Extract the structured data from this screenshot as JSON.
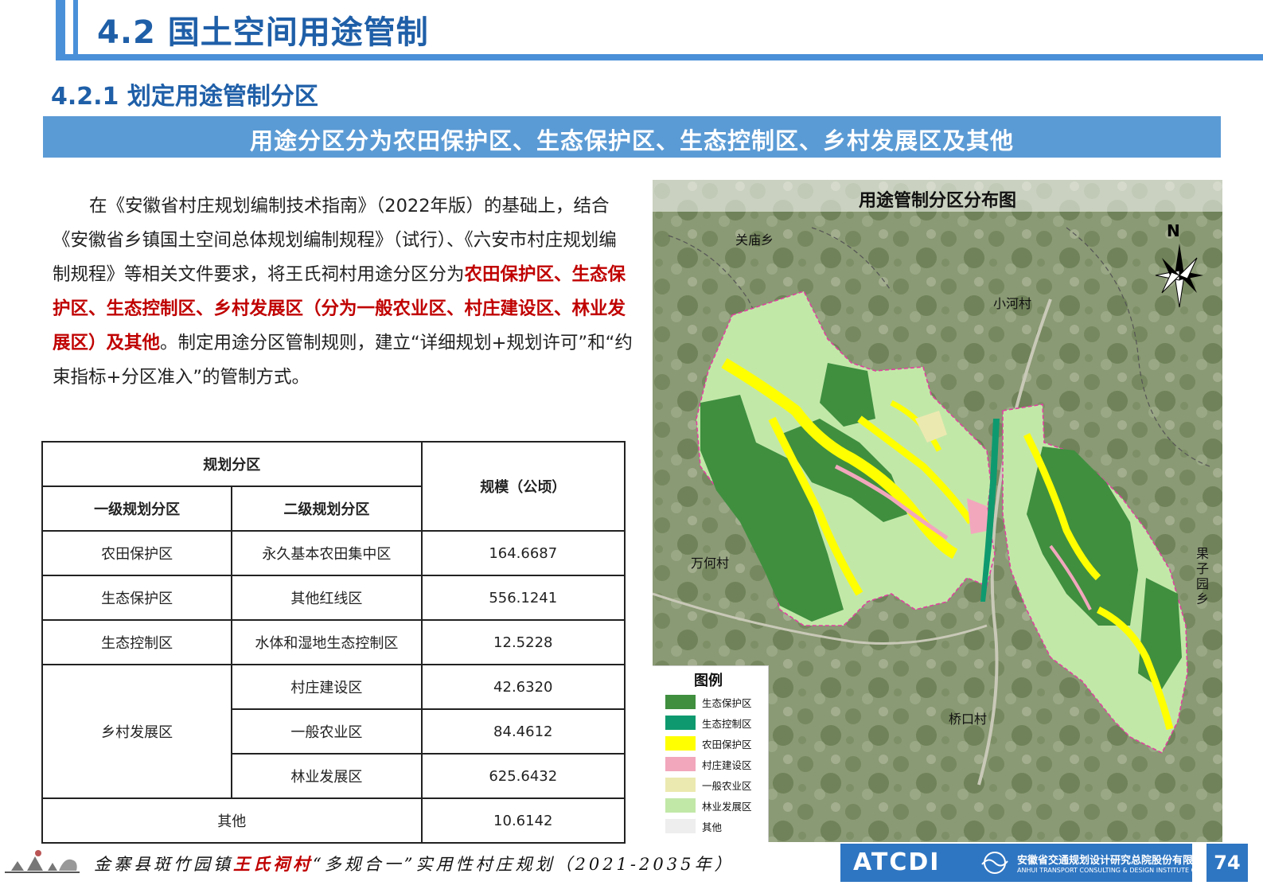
{
  "header": {
    "title": "4.2 国土空间用途管制"
  },
  "section": {
    "title": "4.2.1 划定用途管制分区"
  },
  "banner": {
    "text": "用途分区分为农田保护区、生态保护区、生态控制区、乡村发展区及其他"
  },
  "paragraph": {
    "part1": "在《安徽省村庄规划编制技术指南》（2022年版）的基础上，结合《安徽省乡镇国土空间总体规划编制规程》（试行）、《六安市村庄规划编制规程》等相关文件要求，将王氏祠村用途分区分为",
    "highlight": "农田保护区、生态保护区、生态控制区、乡村发展区（分为一般农业区、村庄建设区、林业发展区）及其他",
    "part2": "。制定用途分区管制规则，建立“详细规划+规划许可”和“约束指标+分区准入”的管制方式。"
  },
  "table": {
    "header_group": "规划分区",
    "col1": "一级规划分区",
    "col2": "二级规划分区",
    "col3": "规模（公顷）",
    "rows": [
      {
        "level1": "农田保护区",
        "level2": "永久基本农田集中区",
        "area": "164.6687"
      },
      {
        "level1": "生态保护区",
        "level2": "其他红线区",
        "area": "556.1241"
      },
      {
        "level1": "生态控制区",
        "level2": "水体和湿地生态控制区",
        "area": "12.5228"
      },
      {
        "level1": "乡村发展区",
        "level2": "村庄建设区",
        "area": "42.6320"
      },
      {
        "level2": "一般农业区",
        "area": "84.4612"
      },
      {
        "level2": "林业发展区",
        "area": "625.6432"
      },
      {
        "level1": "其他",
        "area": "10.6142"
      }
    ]
  },
  "map": {
    "title": "用途管制分区分布图",
    "north_label": "N",
    "places": {
      "guanmiao": "关庙乡",
      "xiaohe": "小河村",
      "wanhe": "万何村",
      "guoziyuan": "果子园乡",
      "qiaokou": "桥口村"
    },
    "legend": {
      "title": "图例",
      "items": [
        {
          "label": "生态保护区",
          "color": "#3f8f3f"
        },
        {
          "label": "生态控制区",
          "color": "#0e9a6e"
        },
        {
          "label": "农田保护区",
          "color": "#ffff00"
        },
        {
          "label": "村庄建设区",
          "color": "#f2a7bd"
        },
        {
          "label": "一般农业区",
          "color": "#ece9b0"
        },
        {
          "label": "林业发展区",
          "color": "#c2e8a8"
        },
        {
          "label": "其他",
          "color": "#eeeeee"
        }
      ]
    }
  },
  "footer": {
    "pre": "金寨县斑竹园镇",
    "highlight": "王氏祠村",
    "post": "“多规合一”实用性村庄规划（2021-2035年）",
    "logo": "ATCDI",
    "company_cn": "安徽省交通规划设计研究总院股份有限公司",
    "company_en": "ANHUI TRANSPORT CONSULTING & DESIGN INSTITUTE CO.,LTD.",
    "page": "74"
  }
}
